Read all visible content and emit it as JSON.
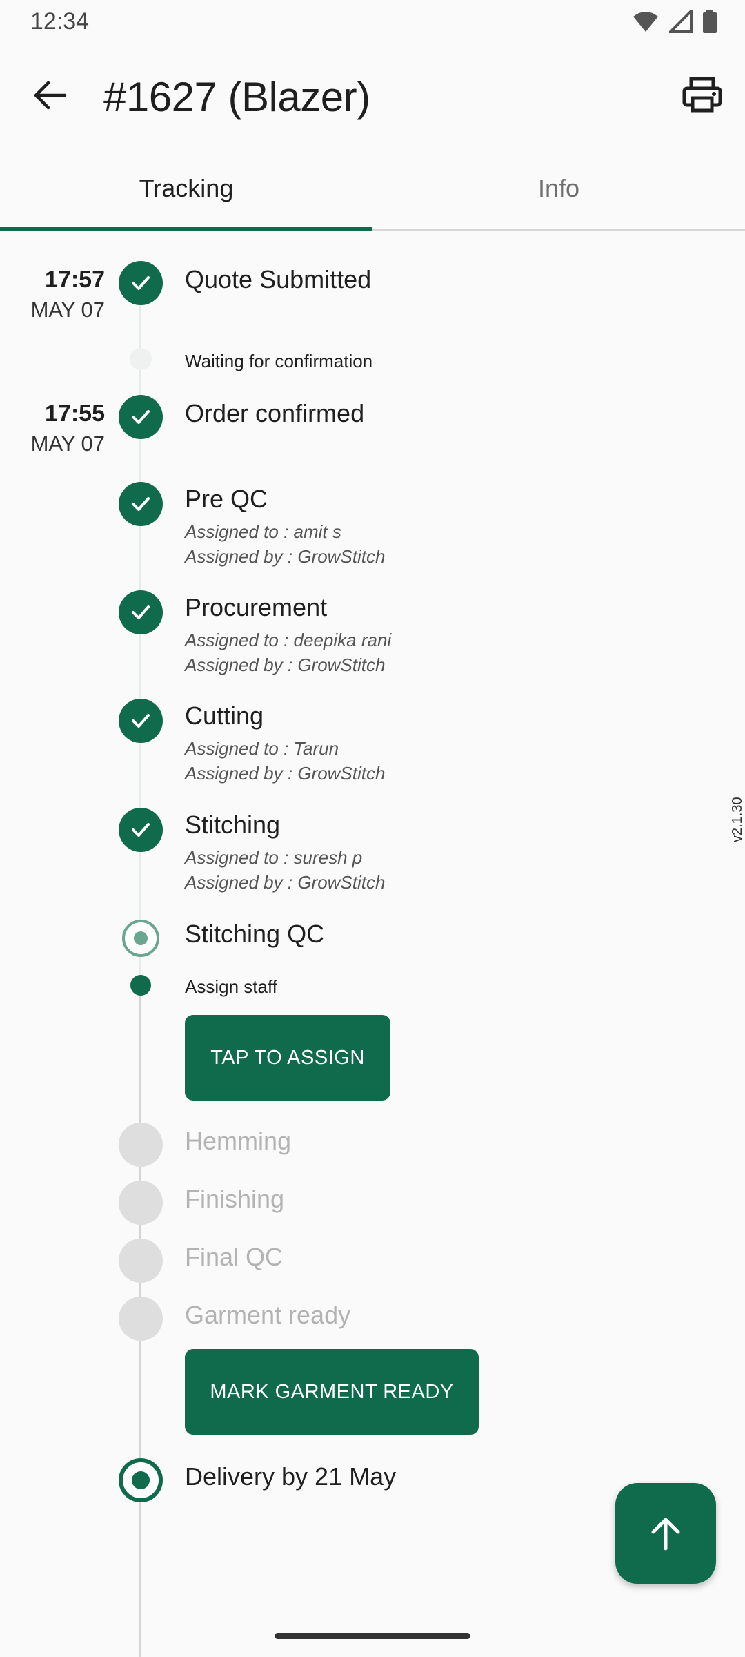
{
  "status_bar": {
    "time": "12:34"
  },
  "header": {
    "title": "#1627 (Blazer)"
  },
  "tabs": [
    {
      "label": "Tracking",
      "active": true
    },
    {
      "label": "Info",
      "active": false
    }
  ],
  "timeline": {
    "quote": {
      "time": "17:57",
      "date": "MAY 07",
      "title": "Quote Submitted"
    },
    "waiting": {
      "label": "Waiting for confirmation"
    },
    "confirmed": {
      "time": "17:55",
      "date": "MAY 07",
      "title": "Order confirmed"
    },
    "steps": [
      {
        "title": "Pre QC",
        "assigned_to": "Assigned to : amit s",
        "assigned_by": "Assigned by : GrowStitch"
      },
      {
        "title": "Procurement",
        "assigned_to": "Assigned to : deepika rani",
        "assigned_by": "Assigned by : GrowStitch"
      },
      {
        "title": "Cutting",
        "assigned_to": "Assigned to : Tarun",
        "assigned_by": "Assigned by : GrowStitch"
      },
      {
        "title": "Stitching",
        "assigned_to": "Assigned to : suresh p",
        "assigned_by": "Assigned by : GrowStitch"
      }
    ],
    "current": {
      "title": "Stitching QC",
      "sub_label": "Assign staff",
      "button_label": "TAP TO ASSIGN"
    },
    "pending": [
      "Hemming",
      "Finishing",
      "Final QC",
      "Garment ready"
    ],
    "garment_ready_button": "MARK GARMENT READY",
    "delivery": "Delivery by 21 May"
  },
  "version": "v2.1.30",
  "colors": {
    "accent": "#0f6b4c",
    "pending": "#dedede"
  }
}
